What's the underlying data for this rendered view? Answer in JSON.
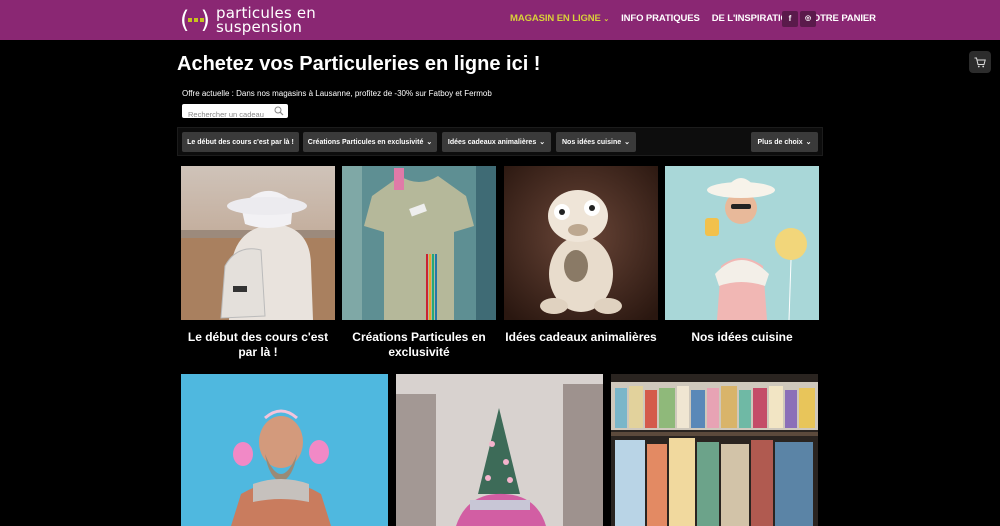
{
  "header": {
    "logo_text_line1": "particules en",
    "logo_text_line2": "suspension",
    "nav": [
      {
        "label": "MAGASIN EN LIGNE",
        "active": true
      },
      {
        "label": "INFO PRATIQUES",
        "active": false
      },
      {
        "label": "DE L'INSPIRATION",
        "active": false
      },
      {
        "label": "VOTRE PANIER",
        "active": false
      }
    ],
    "social": [
      "f",
      "ig"
    ]
  },
  "main": {
    "title": "Achetez vos Particuleries en ligne ici !",
    "offer": "Offre actuelle : Dans nos magasins à Lausanne, profitez de -30% sur Fatboy et Fermob",
    "search_placeholder": "Rechercher un cadeau",
    "filters": [
      "Le début des cours c'est par là !",
      "Créations Particules en exclusivité",
      "Idées cadeaux animalières",
      "Nos idées cuisine"
    ],
    "more_filter": "Plus de choix",
    "cards": [
      {
        "caption": "Le début des cours c'est par là !"
      },
      {
        "caption": "Créations Particules en exclusivité"
      },
      {
        "caption": "Idées cadeaux animalières"
      },
      {
        "caption": "Nos idées cuisine"
      }
    ]
  },
  "colors": {
    "header_bg": "#8a2773",
    "accent": "#d8d03a",
    "page_bg": "#000000"
  },
  "icons": [
    "cart-icon",
    "search-icon",
    "chevron-down-icon",
    "facebook-icon",
    "instagram-icon"
  ]
}
